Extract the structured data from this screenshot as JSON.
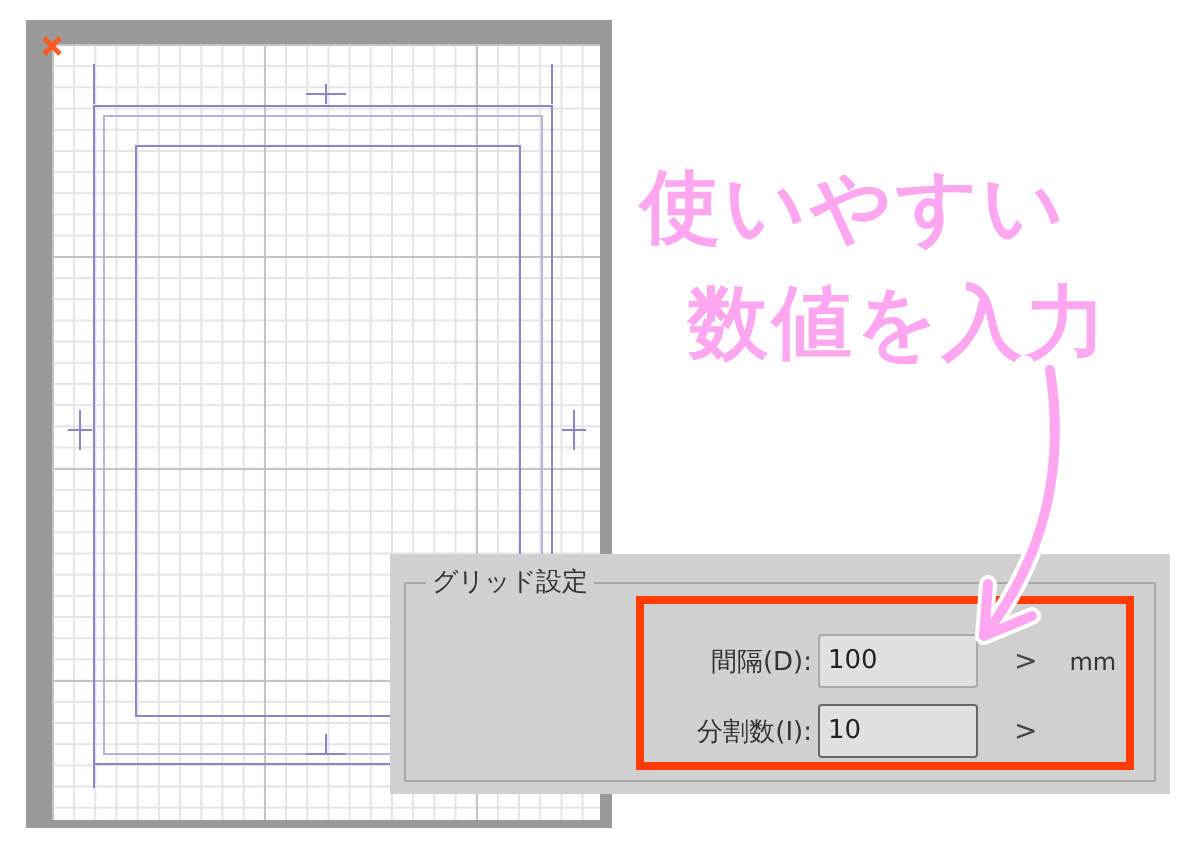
{
  "annotation": {
    "lines": [
      "使いやすい",
      "数値を入力"
    ]
  },
  "grid_settings": {
    "legend": "グリッド設定",
    "highlighted": true,
    "rows": [
      {
        "label": "間隔(D):",
        "value": "100",
        "unit": "mm",
        "focused": false
      },
      {
        "label": "分割数(I):",
        "value": "10",
        "focused": true
      }
    ],
    "stepper": ">"
  }
}
